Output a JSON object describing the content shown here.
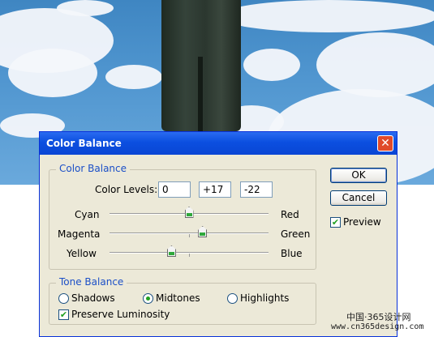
{
  "dialog": {
    "title": "Color Balance",
    "close_glyph": "✕"
  },
  "color_balance": {
    "group_title": "Color Balance",
    "levels_label": "Color Levels:",
    "levels": [
      "0",
      "+17",
      "-22"
    ],
    "sliders": [
      {
        "left": "Cyan",
        "right": "Red",
        "value": 0
      },
      {
        "left": "Magenta",
        "right": "Green",
        "value": 17
      },
      {
        "left": "Yellow",
        "right": "Blue",
        "value": -22
      }
    ],
    "range": [
      -100,
      100
    ]
  },
  "tone_balance": {
    "group_title": "Tone Balance",
    "options": [
      "Shadows",
      "Midtones",
      "Highlights"
    ],
    "selected": "Midtones",
    "preserve_label": "Preserve Luminosity",
    "preserve_checked": true
  },
  "buttons": {
    "ok": "OK",
    "cancel": "Cancel",
    "preview_label": "Preview",
    "preview_checked": true
  },
  "watermark": {
    "line1": "中国·365设计网",
    "line2": "www.cn365design.com"
  },
  "colors": {
    "title_bar": "#0b4fe0",
    "dialog_bg": "#ece9d8",
    "group_title": "#1b4fc7",
    "slider_thumb_fill": "#2fa83b"
  }
}
